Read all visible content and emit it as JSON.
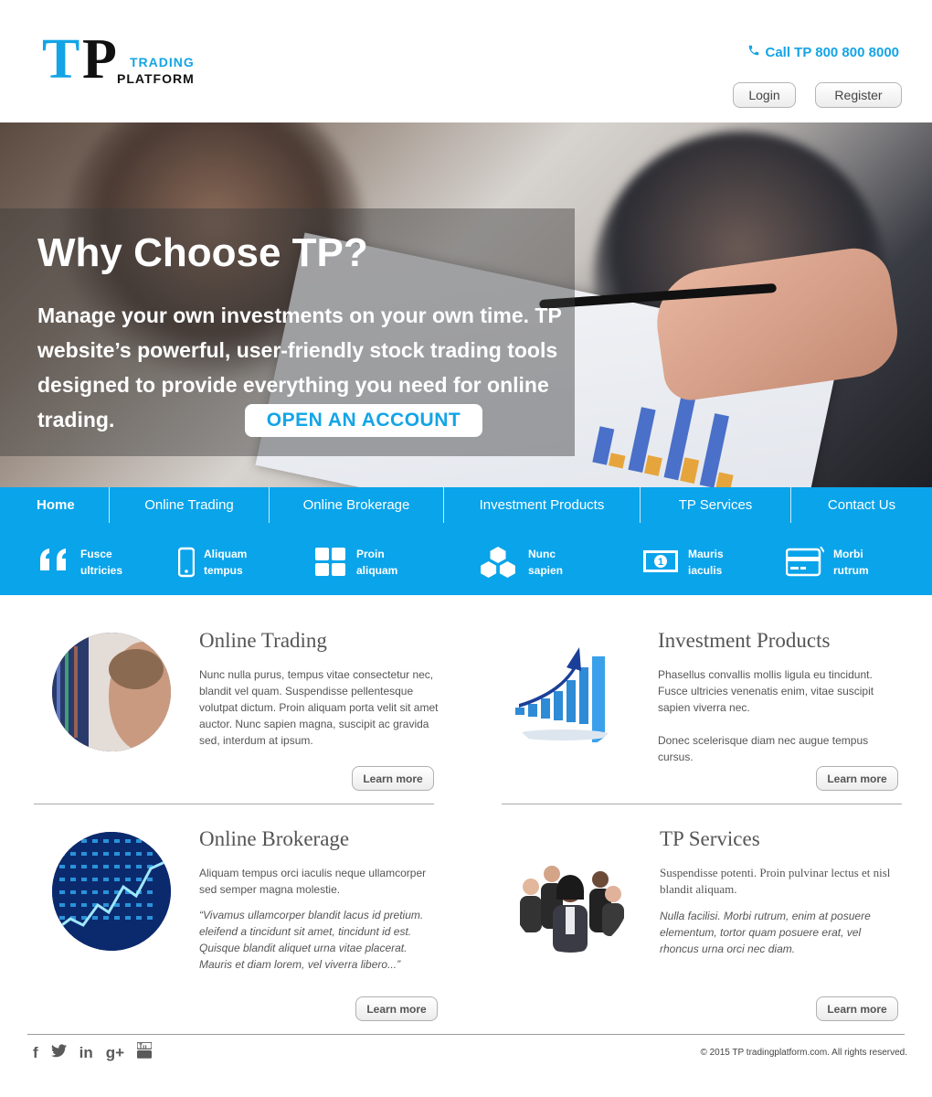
{
  "header": {
    "logo_letter1": "T",
    "logo_letter2": "P",
    "logo_line1": "TRADING",
    "logo_line2": "PLATFORM",
    "call_text": "Call TP 800 800 8000",
    "login_label": "Login",
    "register_label": "Register"
  },
  "hero": {
    "title": "Why Choose TP?",
    "text": "Manage your own investments on your own time. TP website’s powerful, user-friendly stock trading tools designed to provide everything you need for online trading.",
    "cta_label": "OPEN AN ACCOUNT"
  },
  "nav": {
    "items": [
      {
        "label": "Home"
      },
      {
        "label": "Online Trading"
      },
      {
        "label": "Online Brokerage"
      },
      {
        "label": "Investment Products"
      },
      {
        "label": "TP Services"
      },
      {
        "label": "Contact Us"
      }
    ]
  },
  "features": [
    {
      "line1": "Fusce",
      "line2": "ultricies",
      "icon": "quote-icon"
    },
    {
      "line1": "Aliquam",
      "line2": "tempus",
      "icon": "mobile-icon"
    },
    {
      "line1": "Proin",
      "line2": "aliquam",
      "icon": "grid-icon"
    },
    {
      "line1": "Nunc",
      "line2": "sapien",
      "icon": "boxes-icon"
    },
    {
      "line1": "Mauris",
      "line2": "iaculis",
      "icon": "banknote-icon"
    },
    {
      "line1": "Morbi",
      "line2": "rutrum",
      "icon": "credit-card-icon"
    }
  ],
  "cards": {
    "online_trading": {
      "title": "Online Trading",
      "text": "Nunc nulla purus, tempus vitae consectetur nec, blandit vel quam. Suspendisse pellentesque volutpat dictum. Proin aliquam porta velit sit amet auctor. Nunc sapien magna, suscipit ac gravida sed, interdum at ipsum.",
      "button": "Learn more"
    },
    "investment_products": {
      "title": "Investment Products",
      "text1": "Phasellus convallis mollis ligula eu tincidunt. Fusce ultricies venenatis enim, vitae suscipit sapien viverra nec.",
      "text2": "Donec scelerisque diam nec augue tempus cursus.",
      "button": "Learn more"
    },
    "online_brokerage": {
      "title": "Online Brokerage",
      "text1": "Aliquam tempus orci iaculis neque ullamcorper sed semper magna molestie.",
      "text2": "“Vivamus ullamcorper blandit lacus id pretium. eleifend a tincidunt sit amet, tincidunt id est. Quisque blandit aliquet urna vitae placerat. Mauris et diam lorem, vel viverra libero...”",
      "button": "Learn more"
    },
    "tp_services": {
      "title": "TP Services",
      "text1": "Suspendisse potenti. Proin pulvinar lectus et nisl blandit aliquam.",
      "text2": "Nulla facilisi. Morbi rutrum, enim at posuere elementum, tortor quam posuere erat, vel rhoncus urna orci nec diam.",
      "button": "Learn more"
    }
  },
  "footer": {
    "social": [
      "facebook-icon",
      "twitter-icon",
      "linkedin-icon",
      "google-plus-icon",
      "youtube-icon"
    ],
    "social_text": {
      "facebook": "f",
      "linkedin": "in",
      "google": "g+"
    },
    "copyright": "© 2015 TP tradingplatform.com. All rights reserved."
  },
  "colors": {
    "brand_blue": "#0aa4ea",
    "text_dark": "#444444"
  }
}
